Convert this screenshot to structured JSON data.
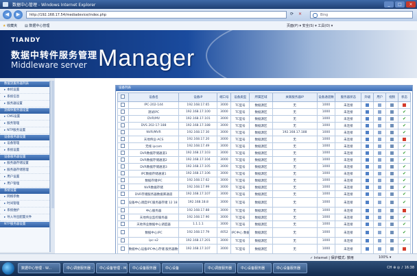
{
  "window": {
    "title": "数据中心管理 - Windows Internet Explorer",
    "buttons": [
      "_",
      "□",
      "×"
    ]
  },
  "addressbar": {
    "url": "http://192.168.17.54/mediadevice/index.php",
    "search_placeholder": "Bing"
  },
  "favorites": {
    "favorites_label": "收藏夹",
    "tab_title": "数据中心管理",
    "tools": "页面(P) ▾  安全(S) ▾  工具(O) ▾"
  },
  "banner": {
    "logo": "TIANDY",
    "cn_title": "数据中转件服务管理",
    "en_title": "Middleware server",
    "big_title": "Manager"
  },
  "sidebar": {
    "items": [
      {
        "type": "section",
        "label": "数据流服务器列表"
      },
      {
        "type": "link",
        "label": "本机设置"
      },
      {
        "type": "link",
        "label": "系统信息"
      },
      {
        "type": "link",
        "label": "服务器设置"
      },
      {
        "type": "section",
        "label": "流媒体服务器设置"
      },
      {
        "type": "link",
        "label": "CMS设置"
      },
      {
        "type": "link",
        "label": "服务管理"
      },
      {
        "type": "link",
        "label": "NTP服务设置"
      },
      {
        "type": "section",
        "label": "设备服务器设置"
      },
      {
        "type": "link",
        "label": "设备管理"
      },
      {
        "type": "link",
        "label": "系统设置"
      },
      {
        "type": "section",
        "label": "设备服务器设置"
      },
      {
        "type": "link",
        "label": "服务器存储设置"
      },
      {
        "type": "link",
        "label": "服务器存储管理"
      },
      {
        "type": "link",
        "label": "用户设置"
      },
      {
        "type": "link",
        "label": "用户管理"
      },
      {
        "type": "section",
        "label": "系统设置"
      },
      {
        "type": "link",
        "label": "网络参数"
      },
      {
        "type": "link",
        "label": "时间管理"
      },
      {
        "type": "link",
        "label": "系统维护"
      },
      {
        "type": "link",
        "label": "导入导出配置文件"
      },
      {
        "type": "section",
        "label": "NTP服务器设置"
      }
    ]
  },
  "table": {
    "title": "设备列表",
    "headers": [
      "",
      "设备名",
      "设备IP",
      "端口号",
      "设备类型",
      "所属区域",
      "关联服务器IP",
      "设备通道数",
      "服务器状态",
      "升级",
      "用户",
      "视频",
      "状态"
    ],
    "rows": [
      [
        "IPC-202-144",
        "192.168.17.65",
        "3000",
        "TC型号",
        "数据源区",
        "无",
        "1000",
        "未连接",
        "err"
      ],
      [
        "测试IPC",
        "192.168.17.100",
        "3000",
        "TC型号",
        "数据源区",
        "无",
        "1000",
        "未连接",
        "ok"
      ],
      [
        "DVR/MV",
        "192.168.17.101",
        "3000",
        "TC型号",
        "数据源区",
        "无",
        "1000",
        "未连接",
        "ok"
      ],
      [
        "DVS 202-17-188",
        "192.168.17.188",
        "3000",
        "TC型号",
        "数据源区",
        "无",
        "1000",
        "未连接",
        "ok"
      ],
      [
        "NVR/MVR",
        "192.168.17.30",
        "3000",
        "TC型号",
        "数据源区",
        "192.168.17.188",
        "1000",
        "未连接",
        "ok"
      ],
      [
        "天地伟业-ACS",
        "192.168.17.20",
        "3000",
        "TC型号",
        "数据源区",
        "无",
        "1000",
        "未连接",
        "err"
      ],
      [
        "无线 ipcam",
        "192.168.17.49",
        "3000",
        "TC型号",
        "数据源区",
        "无",
        "1000",
        "未连接",
        "ok"
      ],
      [
        "DVR数据存储通道1",
        "192.168.17.103",
        "3000",
        "TC型号",
        "数据源区",
        "无",
        "1000",
        "未连接",
        "ok"
      ],
      [
        "DVR数据存储通道2",
        "192.168.17.104",
        "3000",
        "TC型号",
        "数据源区",
        "无",
        "1000",
        "未连接",
        "ok"
      ],
      [
        "DVR数据存储通道3",
        "192.168.17.105",
        "3000",
        "TC型号",
        "数据源区",
        "无",
        "1000",
        "未连接",
        "ok"
      ],
      [
        "IPC数据存储通道1",
        "192.168.17.106",
        "3000",
        "TC型号",
        "数据源区",
        "无",
        "1000",
        "未连接",
        "ok"
      ],
      [
        "数据存储IPC",
        "192.168.17.62",
        "3000",
        "TC型号",
        "数据源区",
        "无",
        "1000",
        "未连接",
        "ok"
      ],
      [
        "NVR数据存储",
        "192.168.17.99",
        "3000",
        "TC型号",
        "数据源区",
        "无",
        "1000",
        "未连接",
        "ok"
      ],
      [
        "DVR存储服务器数据库通道",
        "192.168.17.107",
        "3000",
        "TC型号",
        "数据源区",
        "无",
        "1000",
        "未连接",
        "ok"
      ],
      [
        "设备中心调度IPC服务器存储\n12 18 79 0",
        "192.168.18.8",
        "3000",
        "TC型号",
        "数据源区",
        "无",
        "1000",
        "未连接",
        "ok",
        "tall"
      ],
      [
        "中心服务器",
        "192.168.17.88",
        "3000",
        "TC型号",
        "数据源区",
        "无",
        "1000",
        "未连接",
        "err"
      ],
      [
        "天地伟业监控服务器",
        "192.168.17.90",
        "3000",
        "TC型号",
        "数据源区",
        "无",
        "1000",
        "未连接",
        "ok"
      ],
      [
        "天地伟业数据中心调度器",
        "1.1.1.1",
        "3000",
        "TC型号",
        "数据源区",
        "无",
        "1000",
        "未连接",
        "ok"
      ],
      [
        "数据中心IPC",
        "192.168.17.79",
        "4052",
        "IPC中心\n数据源",
        "数据源区",
        "无",
        "1000",
        "未连接",
        "ok",
        "tall"
      ],
      [
        "ipc-x2",
        "192.168.17.201",
        "3000",
        "TC型号",
        "数据源区",
        "无",
        "1000",
        "未连接",
        "ok"
      ],
      [
        "数据中心设备IPC中心存储\n服务器数据库",
        "192.168.17.107",
        "3000",
        "TC型号",
        "数据源区",
        "无",
        "1000",
        "未连接",
        "err",
        "tall"
      ],
      [
        "数据存储中心 IPC服务器\n存储服务器",
        "192.168.16.176",
        "3000",
        "TC型号",
        "数据源区",
        "无",
        "1000",
        "未连接",
        "ok",
        "tall"
      ]
    ]
  },
  "statusbar": {
    "zone": "✓ Internet | 保护模式: 禁用",
    "zoom": "100% ▾"
  },
  "taskbar": {
    "items": [
      "数据中心管理 - W...",
      "中心调度服务器 - M...",
      "中心设备管理 - M...",
      "中心设备服务器",
      "中心设备",
      "中心调度服务器",
      "中心设备服务器",
      "中心设备服务器"
    ],
    "tray": "CH  ⊕  ◎  ♪  16:38"
  },
  "colors": {
    "accent": "#1f3f73",
    "error": "#d43a2a",
    "ok": "#2e9a2e"
  }
}
